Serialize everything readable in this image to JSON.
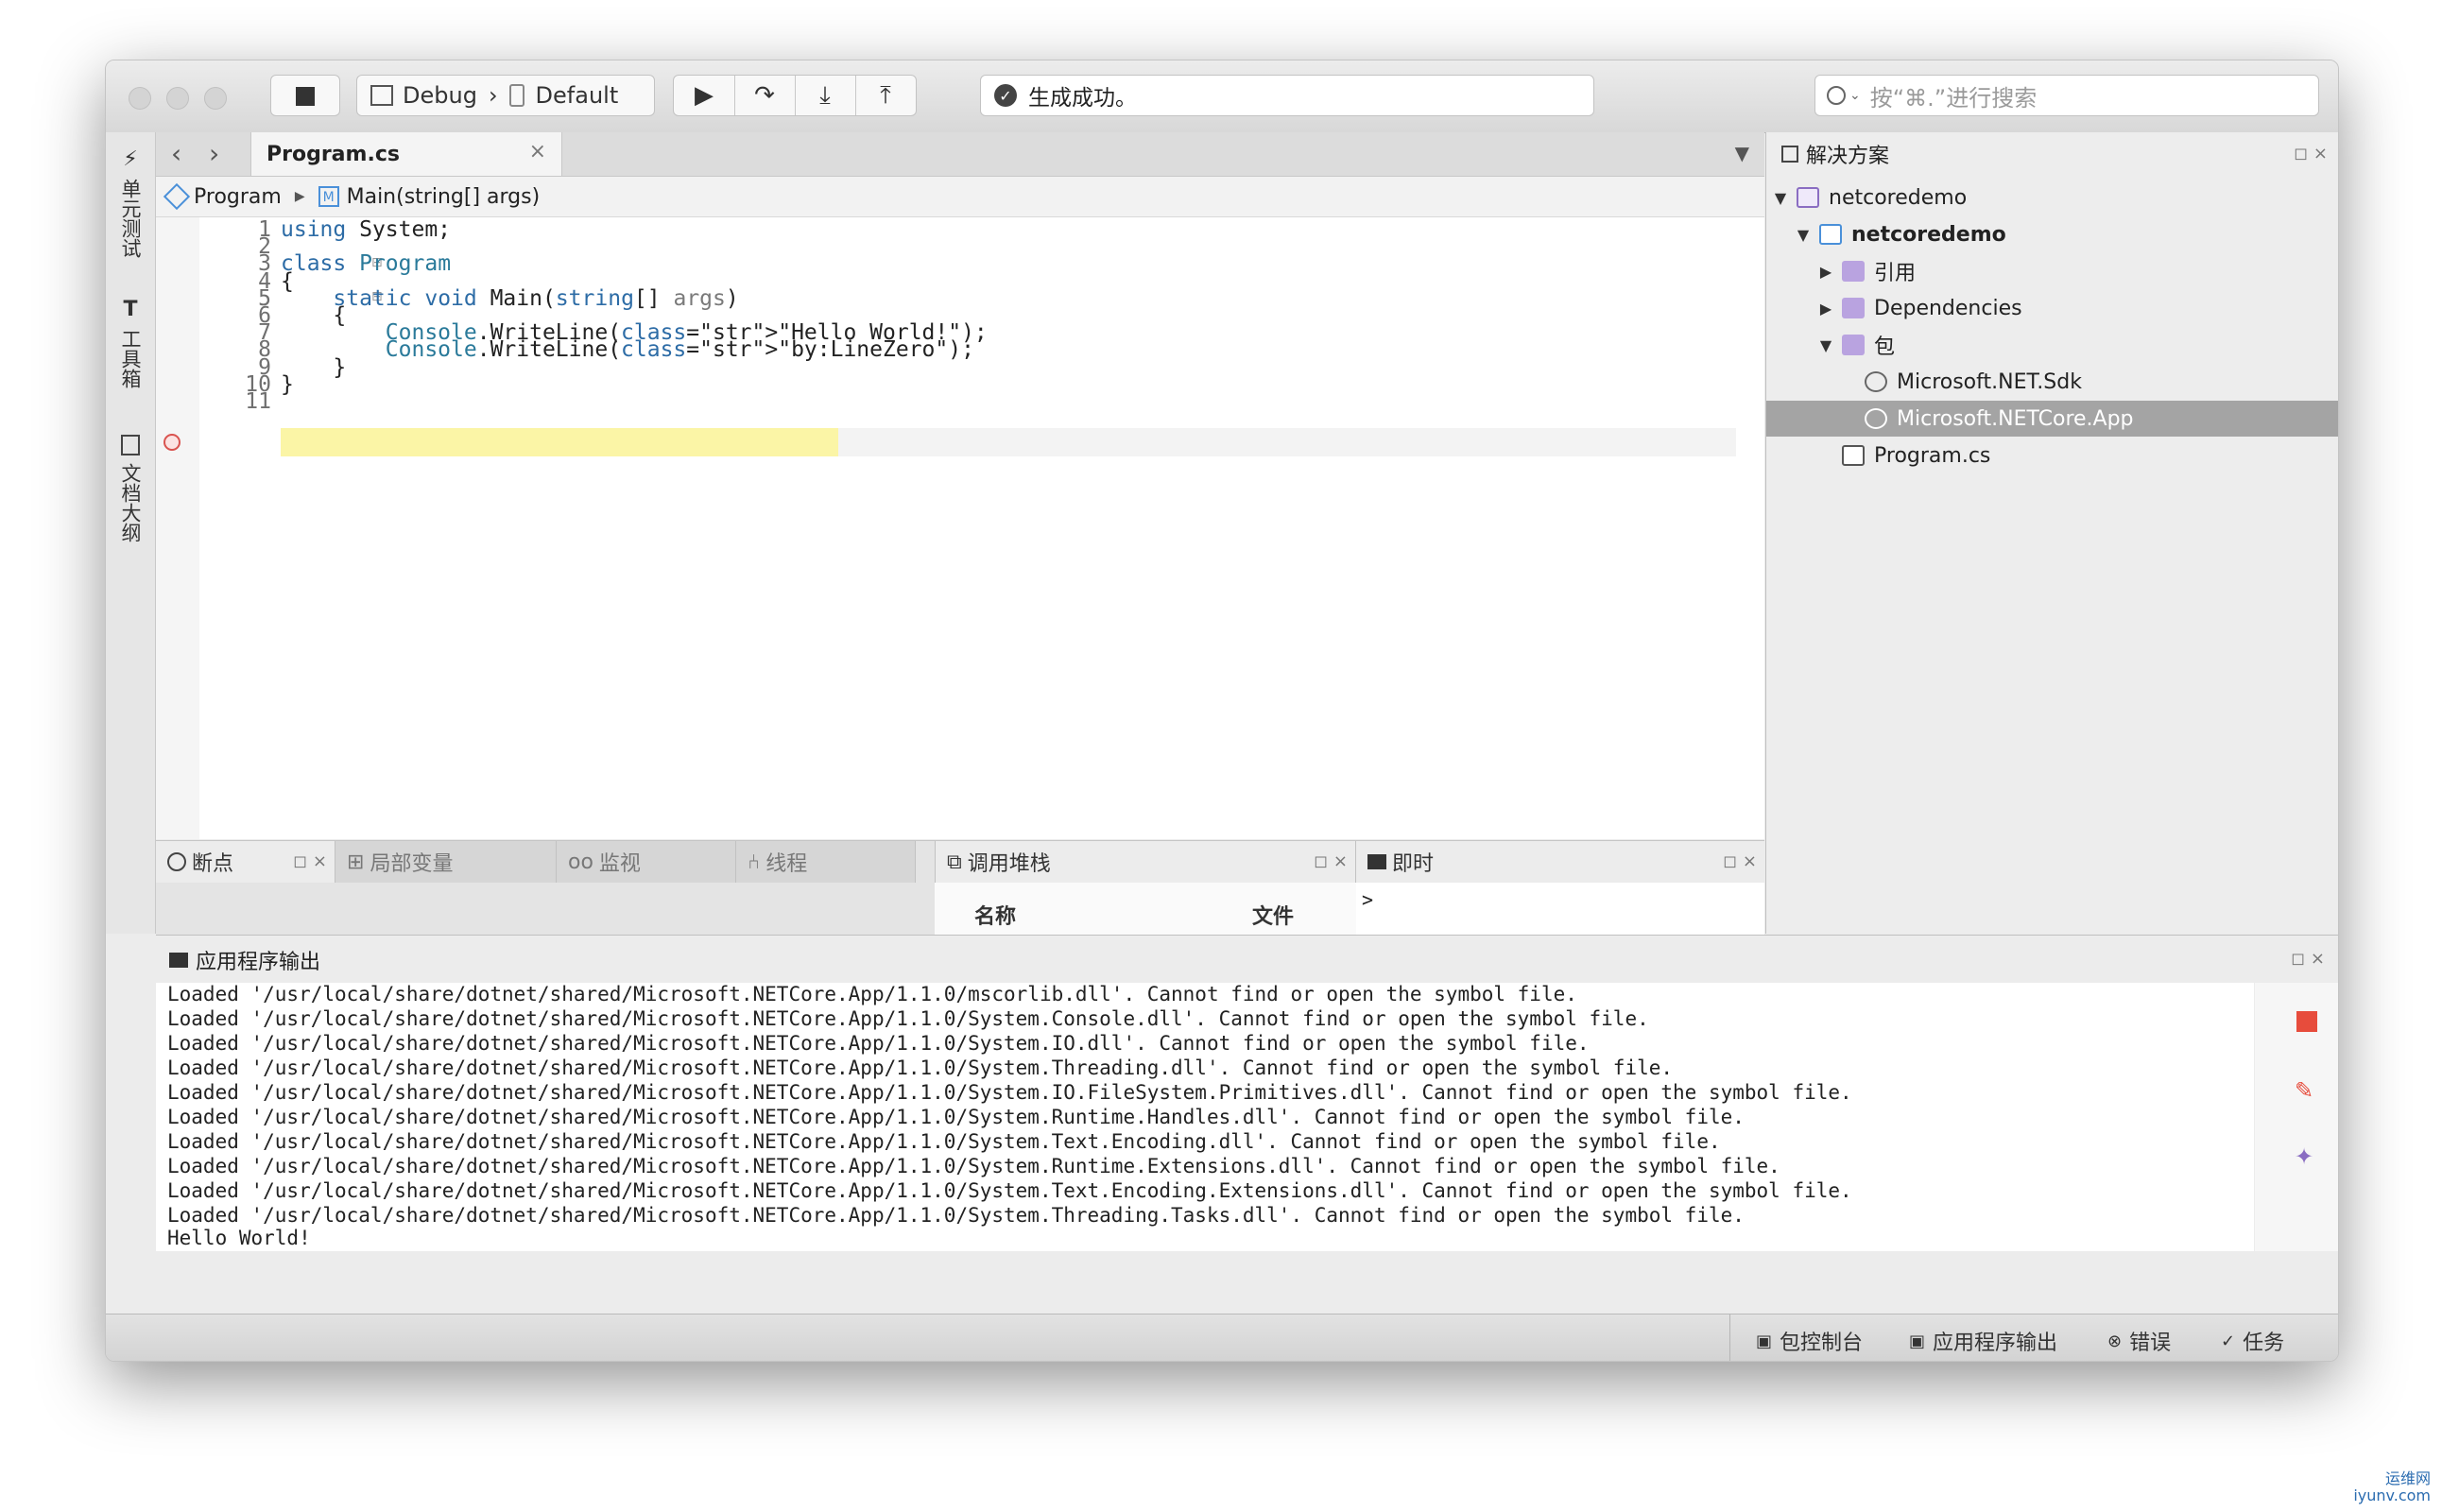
{
  "toolbar": {
    "config": "Debug",
    "separator": "›",
    "target": "Default",
    "status_text": "生成成功。",
    "search_placeholder": "按“⌘.”进行搜索"
  },
  "left_pads": [
    "单元测试",
    "工具箱",
    "文档大纲"
  ],
  "editor": {
    "tab_title": "Program.cs",
    "breadcrumb": [
      "Program",
      "Main(string[] args)"
    ],
    "lines": [
      {
        "num": "1",
        "text": "using System;"
      },
      {
        "num": "2",
        "text": ""
      },
      {
        "num": "3",
        "text": "class Program"
      },
      {
        "num": "4",
        "text": "{"
      },
      {
        "num": "5",
        "text": "    static void Main(string[] args)"
      },
      {
        "num": "6",
        "text": "    {"
      },
      {
        "num": "7",
        "text": "        Console.WriteLine(\"Hello World!\");"
      },
      {
        "num": "8",
        "text": "        Console.WriteLine(\"by:LineZero\");"
      },
      {
        "num": "9",
        "text": "    }"
      },
      {
        "num": "10",
        "text": "}"
      },
      {
        "num": "11",
        "text": ""
      }
    ]
  },
  "debug_pads": {
    "breakpoints": "断点",
    "locals": "局部变量",
    "watch": "监视",
    "threads": "线程",
    "callstack": "调用堆栈",
    "immediate": "即时",
    "col_name": "名称",
    "col_file": "文件",
    "prompt": ">"
  },
  "solution": {
    "title": "解决方案",
    "items": [
      {
        "label": "netcoredemo",
        "level": 0,
        "expanded": true
      },
      {
        "label": "netcoredemo",
        "level": 1,
        "expanded": true,
        "bold": true
      },
      {
        "label": "引用",
        "level": 2,
        "expanded": false
      },
      {
        "label": "Dependencies",
        "level": 2,
        "expanded": false
      },
      {
        "label": "包",
        "level": 2,
        "expanded": true
      },
      {
        "label": "Microsoft.NET.Sdk",
        "level": 3
      },
      {
        "label": "Microsoft.NETCore.App",
        "level": 3,
        "selected": true
      },
      {
        "label": "Program.cs",
        "level": 2
      }
    ]
  },
  "output": {
    "title": "应用程序输出",
    "lines": [
      "Loaded '/usr/local/share/dotnet/shared/Microsoft.NETCore.App/1.1.0/mscorlib.dll'. Cannot find or open the symbol file.",
      "Loaded '/usr/local/share/dotnet/shared/Microsoft.NETCore.App/1.1.0/System.Console.dll'. Cannot find or open the symbol file.",
      "Loaded '/usr/local/share/dotnet/shared/Microsoft.NETCore.App/1.1.0/System.IO.dll'. Cannot find or open the symbol file.",
      "Loaded '/usr/local/share/dotnet/shared/Microsoft.NETCore.App/1.1.0/System.Threading.dll'. Cannot find or open the symbol file.",
      "Loaded '/usr/local/share/dotnet/shared/Microsoft.NETCore.App/1.1.0/System.IO.FileSystem.Primitives.dll'. Cannot find or open the symbol file.",
      "Loaded '/usr/local/share/dotnet/shared/Microsoft.NETCore.App/1.1.0/System.Runtime.Handles.dll'. Cannot find or open the symbol file.",
      "Loaded '/usr/local/share/dotnet/shared/Microsoft.NETCore.App/1.1.0/System.Text.Encoding.dll'. Cannot find or open the symbol file.",
      "Loaded '/usr/local/share/dotnet/shared/Microsoft.NETCore.App/1.1.0/System.Runtime.Extensions.dll'. Cannot find or open the symbol file.",
      "Loaded '/usr/local/share/dotnet/shared/Microsoft.NETCore.App/1.1.0/System.Text.Encoding.Extensions.dll'. Cannot find or open the symbol file.",
      "Loaded '/usr/local/share/dotnet/shared/Microsoft.NETCore.App/1.1.0/System.Threading.Tasks.dll'. Cannot find or open the symbol file.",
      "Hello World!"
    ]
  },
  "statusbar": {
    "package_console": "包控制台",
    "app_output": "应用程序输出",
    "errors": "错误",
    "tasks": "任务"
  },
  "watermark": {
    "line1": "运维网",
    "line2": "iyunv.com"
  },
  "colors": {
    "highlight": "#fbf5a6",
    "keyword": "#2d6ca6",
    "string": "#c0392b",
    "selection": "#a4a4a4"
  }
}
